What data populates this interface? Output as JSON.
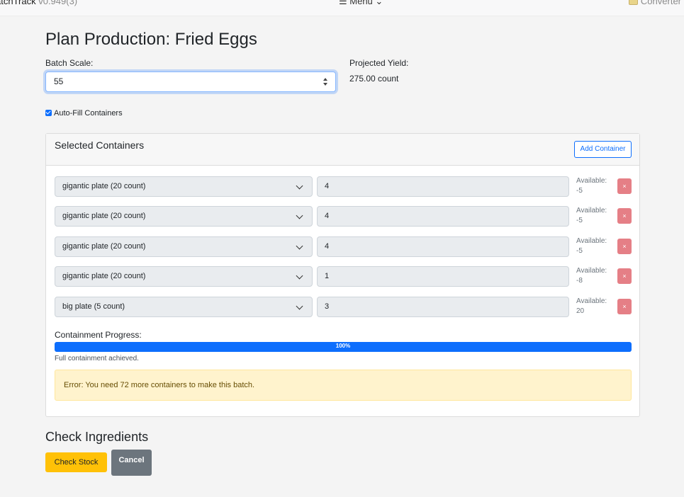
{
  "topbar": {
    "brand": "atchTrack",
    "version": "v0.949(3)",
    "menu": "☰ Menu ⌄",
    "converter": "Converter"
  },
  "page": {
    "title": "Plan Production: Fried Eggs",
    "batch_scale_label": "Batch Scale:",
    "batch_scale_value": "55",
    "projected_yield_label": "Projected Yield:",
    "projected_yield_value": "275.00 count",
    "autofill_label": "Auto-Fill Containers",
    "autofill_checked": true
  },
  "containers": {
    "title": "Selected Containers",
    "add_label": "Add Container",
    "rows": [
      {
        "container": "gigantic plate (20 count)",
        "quantity": "4",
        "available_label": "Available:",
        "available": "-5",
        "remove": "×"
      },
      {
        "container": "gigantic plate (20 count)",
        "quantity": "4",
        "available_label": "Available:",
        "available": "-5",
        "remove": "×"
      },
      {
        "container": "gigantic plate (20 count)",
        "quantity": "4",
        "available_label": "Available:",
        "available": "-5",
        "remove": "×"
      },
      {
        "container": "gigantic plate (20 count)",
        "quantity": "1",
        "available_label": "Available:",
        "available": "-8",
        "remove": "×"
      },
      {
        "container": "big plate (5 count)",
        "quantity": "3",
        "available_label": "Available:",
        "available": "20",
        "remove": "×"
      }
    ],
    "progress_label": "Containment Progress:",
    "progress_text": "100%",
    "progress_fraction": 1.0,
    "progress_note": "Full containment achieved.",
    "error": "Error: You need 72 more containers to make this batch."
  },
  "ingredients": {
    "title": "Check Ingredients",
    "check_stock_label": "Check Stock",
    "cancel_label": "Cancel"
  },
  "colors": {
    "primary": "#0d6efd",
    "warning_button": "#ffc107",
    "danger_soft": "#e57f86",
    "secondary": "#6c757d",
    "alert_bg": "#fff3cd"
  }
}
